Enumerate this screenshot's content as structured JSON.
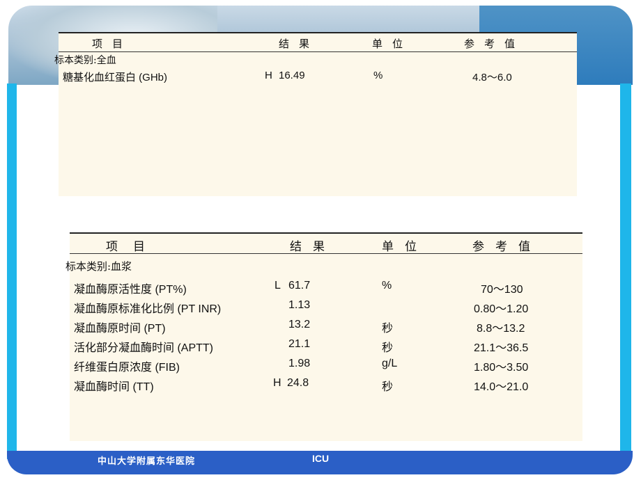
{
  "footer": {
    "hospital": "中山大学附属东华医院",
    "unit": "ICU"
  },
  "report1": {
    "headers": {
      "item": "项目",
      "result": "结果",
      "unit": "单位",
      "reference": "参考值"
    },
    "sample_type": "标本类别:全血",
    "rows": [
      {
        "item": "糖基化血红蛋白 (GHb)",
        "flag": "H",
        "result": "16.49",
        "unit": "%",
        "reference": "4.8～6.0"
      }
    ]
  },
  "report2": {
    "headers": {
      "item": "项目",
      "result": "结果",
      "unit": "单位",
      "reference": "参考值"
    },
    "sample_type": "标本类别:血浆",
    "rows": [
      {
        "item": "凝血酶原活性度 (PT%)",
        "flag": "L",
        "result": "61.7",
        "unit": "%",
        "reference": "70～130"
      },
      {
        "item": "凝血酶原标准化比例 (PT INR)",
        "flag": "",
        "result": "1.13",
        "unit": "",
        "reference": "0.80～1.20"
      },
      {
        "item": "凝血酶原时间 (PT)",
        "flag": "",
        "result": "13.2",
        "unit": "秒",
        "reference": "8.8～13.2"
      },
      {
        "item": "活化部分凝血酶时间 (APTT)",
        "flag": "",
        "result": "21.1",
        "unit": "秒",
        "reference": "21.1～36.5"
      },
      {
        "item": "纤维蛋白原浓度 (FIB)",
        "flag": "",
        "result": "1.98",
        "unit": "g/L",
        "reference": "1.80～3.50"
      },
      {
        "item": "凝血酶时间 (TT)",
        "flag": "H",
        "result": "24.8",
        "unit": "秒",
        "reference": "14.0～21.0"
      }
    ]
  }
}
